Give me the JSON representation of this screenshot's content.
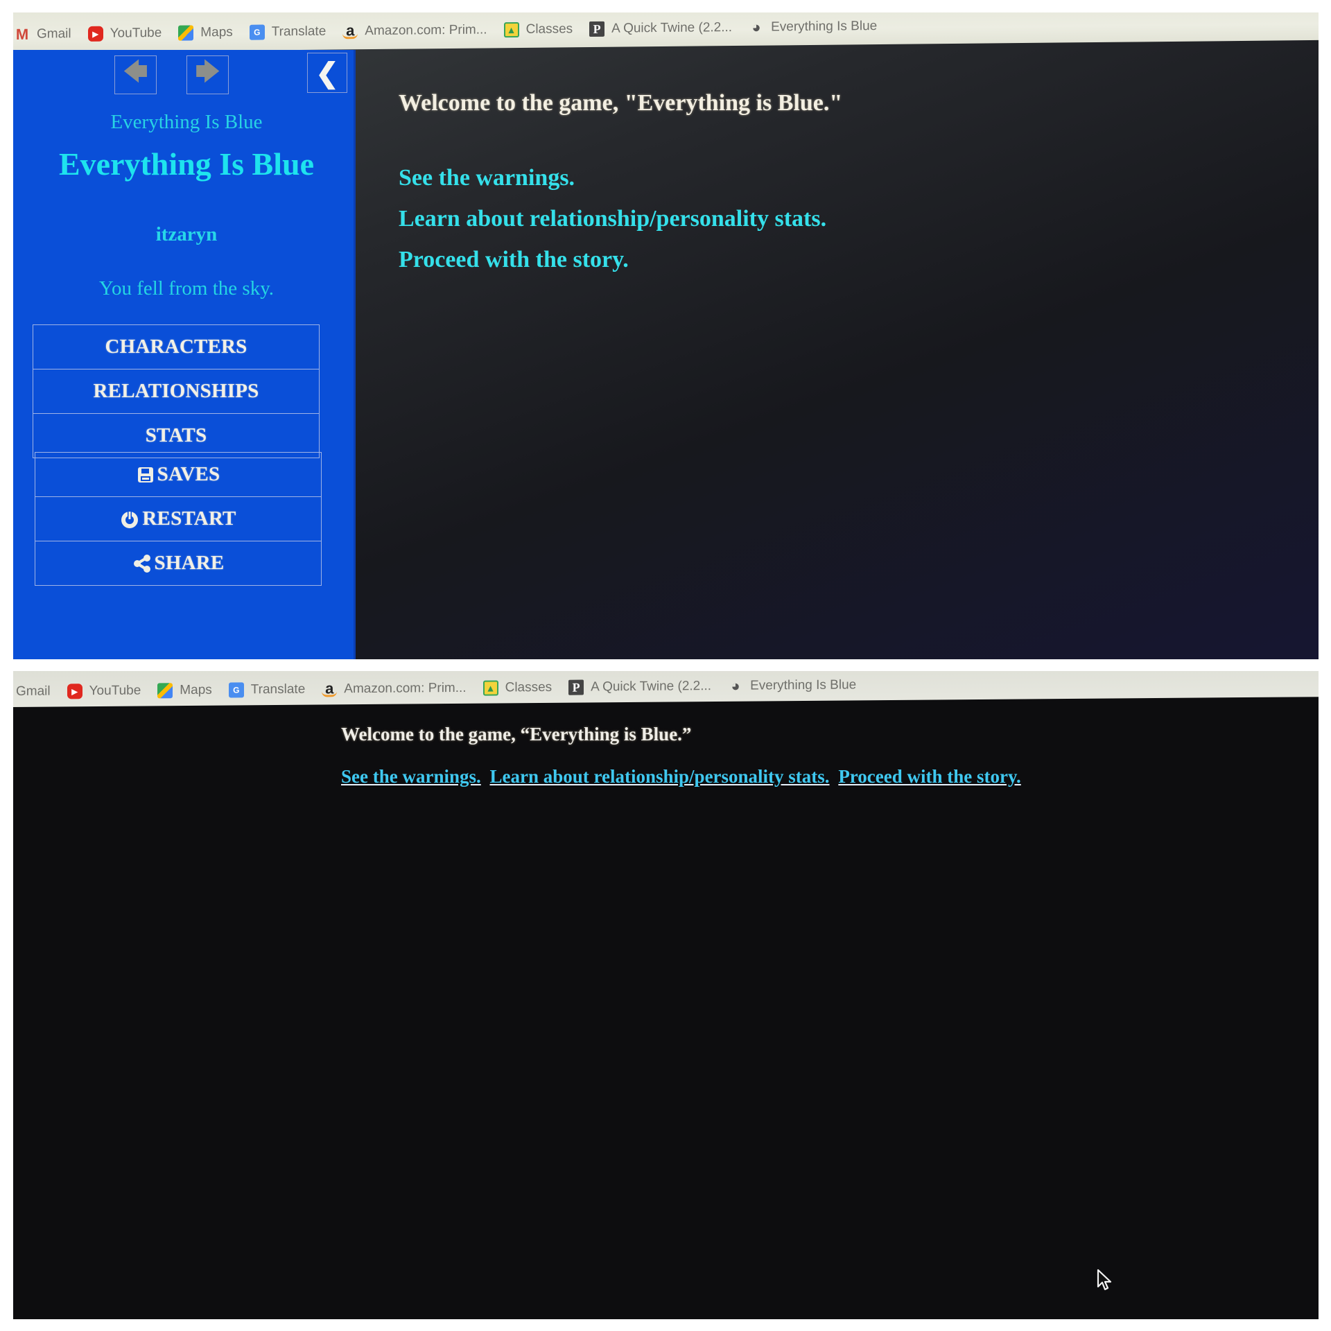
{
  "bookmarks": [
    {
      "label": "Gmail",
      "icon": "gmail-icon",
      "glyph": "M"
    },
    {
      "label": "YouTube",
      "icon": "youtube-icon",
      "glyph": "▶"
    },
    {
      "label": "Maps",
      "icon": "maps-icon",
      "glyph": ""
    },
    {
      "label": "Translate",
      "icon": "translate-icon",
      "glyph": "G"
    },
    {
      "label": "Amazon.com: Prim...",
      "icon": "amazon-icon",
      "glyph": "a"
    },
    {
      "label": "Classes",
      "icon": "classroom-icon",
      "glyph": "👤"
    },
    {
      "label": "A Quick Twine (2.2...",
      "icon": "twine-p-icon",
      "glyph": "P"
    },
    {
      "label": "Everything Is Blue",
      "icon": "globe-icon",
      "glyph": "🌐"
    }
  ],
  "top_screen": {
    "nav": {
      "back_glyph": "🡄",
      "forward_glyph": "🡆",
      "toggle_glyph": "❮"
    },
    "story_subtitle": "Everything Is Blue",
    "story_title": "Everything Is Blue",
    "story_author": "itzaryn",
    "story_caption": "You fell from the sky.",
    "story_menu": [
      "CHARACTERS",
      "RELATIONSHIPS",
      "STATS"
    ],
    "core_menu": [
      {
        "label": "SAVES",
        "icon": "floppy-disk-icon",
        "glyph": "💾"
      },
      {
        "label": "RESTART",
        "icon": "power-icon",
        "glyph": "⏻"
      },
      {
        "label": "SHARE",
        "icon": "share-icon",
        "glyph": "⋖"
      }
    ],
    "passage": {
      "welcome": "Welcome to the game, \"Everything is Blue.\"",
      "links": [
        "See the warnings.",
        "Learn about relationship/personality stats.",
        "Proceed with the story."
      ]
    }
  },
  "bottom_screen": {
    "passage": {
      "welcome": "Welcome to the game, “Everything is Blue.”",
      "links": [
        "See the warnings.",
        "Learn about relationship/personality stats.",
        "Proceed with the story."
      ]
    }
  },
  "colors": {
    "sidebar_blue": "#0a4fd8",
    "title_cyan": "#1ee3ee",
    "link_cyan": "#35e0ea",
    "bottom_link": "#3fc8f0"
  }
}
